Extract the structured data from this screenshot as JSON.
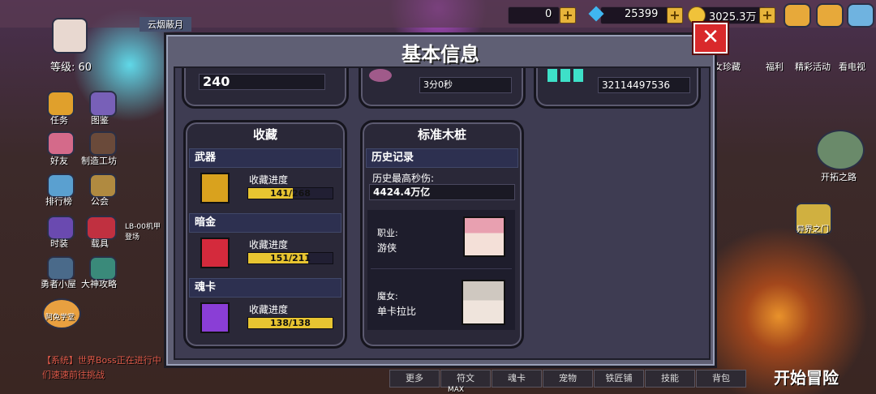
{
  "hud": {
    "player_name": "云烟蔽月",
    "level": "等级: 60",
    "res1_value": "0",
    "res2_value": "25399",
    "res3_value": "3025.3万",
    "left_menu": [
      "任务",
      "图鉴",
      "好友",
      "制造工坊",
      "排行榜",
      "公会",
      "时装",
      "载具",
      "勇者小屋",
      "大神攻略",
      "阿兔学堂"
    ],
    "vehicle_note": "LB-00机甲 登场",
    "right_menu": [
      "女珍藏",
      "福利",
      "精彩活动",
      "看电视",
      "开拓之路",
      "异界之门"
    ],
    "chat_line1": "【系统】世界Boss正在进行中",
    "chat_line2": "们速速前往挑战",
    "bottom_tabs": [
      "更多",
      "符文",
      "魂卡",
      "宠物",
      "铁匠铺",
      "技能",
      "背包"
    ],
    "start_button": "开始冒险",
    "max_label": "MAX"
  },
  "modal": {
    "title": "基本信息",
    "close_label": "✕",
    "top_row": {
      "card1_value": "240",
      "card2_value": "3分0秒",
      "card3_value": "32114497536"
    },
    "collection": {
      "title": "收藏",
      "sections": [
        {
          "name": "武器",
          "progress_label": "收藏进度",
          "progress_text": "141/268",
          "current": 141,
          "total": 268,
          "icon_color": "#d9a21e"
        },
        {
          "name": "暗金",
          "progress_label": "收藏进度",
          "progress_text": "151/211",
          "current": 151,
          "total": 211,
          "icon_color": "#d42a3c"
        },
        {
          "name": "魂卡",
          "progress_label": "收藏进度",
          "progress_text": "138/138",
          "current": 138,
          "total": 138,
          "icon_color": "#8a3ed6"
        }
      ]
    },
    "dummy": {
      "title": "标准木桩",
      "history_label": "历史记录",
      "max_dps_label": "历史最高秒伤:",
      "max_dps_value": "4424.4万亿",
      "class_label": "职业:",
      "class_value": "游侠",
      "witch_label": "魔女:",
      "witch_value": "单卡拉比"
    }
  }
}
